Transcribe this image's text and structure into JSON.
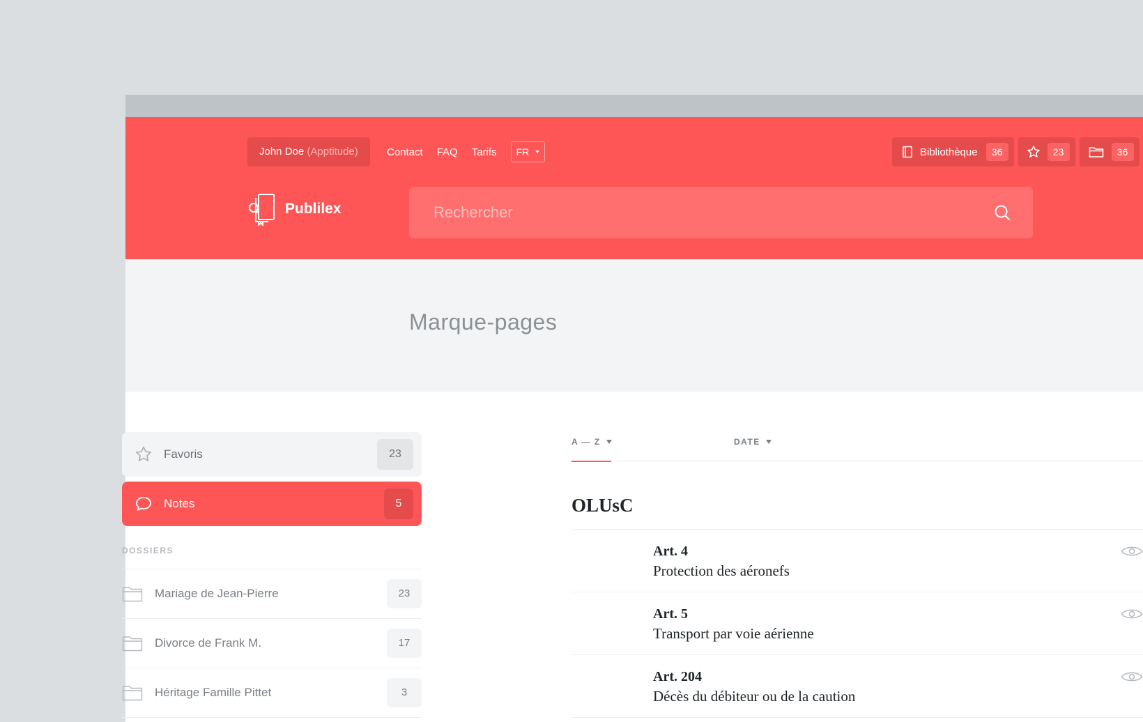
{
  "header": {
    "user_name": "John Doe",
    "user_org": "(Apptitude)",
    "nav": [
      "Contact",
      "FAQ",
      "Tarifs"
    ],
    "language": "FR",
    "library_label": "Bibliothèque",
    "library_count": "36",
    "favorites_count": "23",
    "folders_count": "36",
    "brand_name": "Publilex",
    "search_placeholder": "Rechercher"
  },
  "page_title": "Marque-pages",
  "sidebar": {
    "favorites_label": "Favoris",
    "favorites_count": "23",
    "notes_label": "Notes",
    "notes_count": "5",
    "folders_heading": "DOSSIERS",
    "folders": [
      {
        "name": "Mariage de Jean-Pierre",
        "count": "23"
      },
      {
        "name": "Divorce de Frank M.",
        "count": "17"
      },
      {
        "name": "Héritage Famille Pittet",
        "count": "3"
      }
    ]
  },
  "content": {
    "sort_az": "A — Z",
    "sort_date": "DATE",
    "group_title": "OLUsC",
    "articles": [
      {
        "number": "Art. 4",
        "title": "Protection des aéronefs"
      },
      {
        "number": "Art. 5",
        "title": "Transport par voie aérienne"
      },
      {
        "number": "Art. 204",
        "title": "Décès du débiteur ou de la caution"
      }
    ]
  },
  "colors": {
    "accent": "#fe5656",
    "accent_dark": "#e54b4b",
    "background": "#dadee1",
    "band": "#f3f4f5"
  },
  "icons": [
    "book-icon",
    "star-icon",
    "folder-icon",
    "search-icon",
    "logo-icon",
    "comment-icon",
    "eye-icon"
  ]
}
